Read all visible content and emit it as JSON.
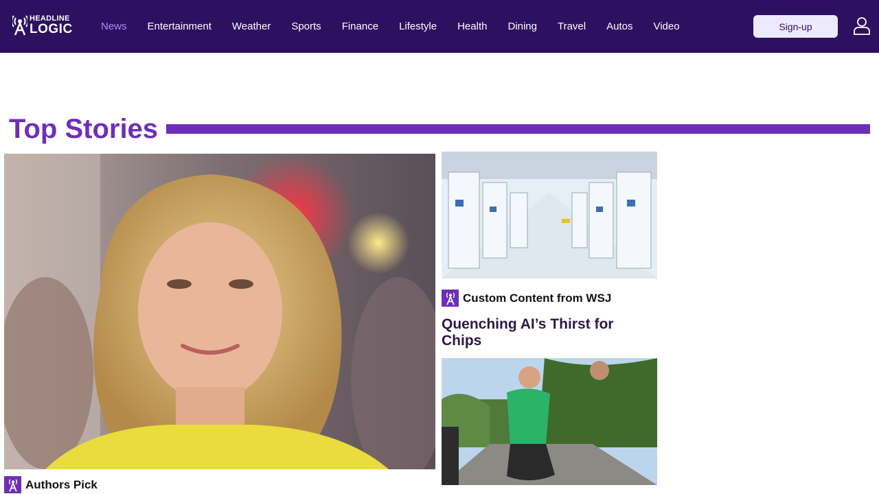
{
  "header": {
    "logo": {
      "line1": "HEADLINE",
      "line2": "LOGIC"
    },
    "nav": [
      {
        "label": "News",
        "active": true
      },
      {
        "label": "Entertainment",
        "active": false
      },
      {
        "label": "Weather",
        "active": false
      },
      {
        "label": "Sports",
        "active": false
      },
      {
        "label": "Finance",
        "active": false
      },
      {
        "label": "Lifestyle",
        "active": false
      },
      {
        "label": "Health",
        "active": false
      },
      {
        "label": "Dining",
        "active": false
      },
      {
        "label": "Travel",
        "active": false
      },
      {
        "label": "Autos",
        "active": false
      },
      {
        "label": "Video",
        "active": false
      }
    ],
    "signup_label": "Sign-up",
    "user_icon": "user-icon"
  },
  "main": {
    "section_title": "Top Stories",
    "hero": {
      "image": "woman-portrait-photo",
      "source": "Authors Pick"
    },
    "side_story_1": {
      "image": "chip-factory-photo",
      "source": "Custom Content from WSJ",
      "title": "Quenching AI’s Thirst for Chips"
    },
    "side_story_2": {
      "image": "bodycam-photo"
    }
  },
  "colors": {
    "header_bg": "#2e1061",
    "accent": "#6d2fb8",
    "nav_active": "#a78bfa",
    "signup_bg": "#eeeafd"
  }
}
